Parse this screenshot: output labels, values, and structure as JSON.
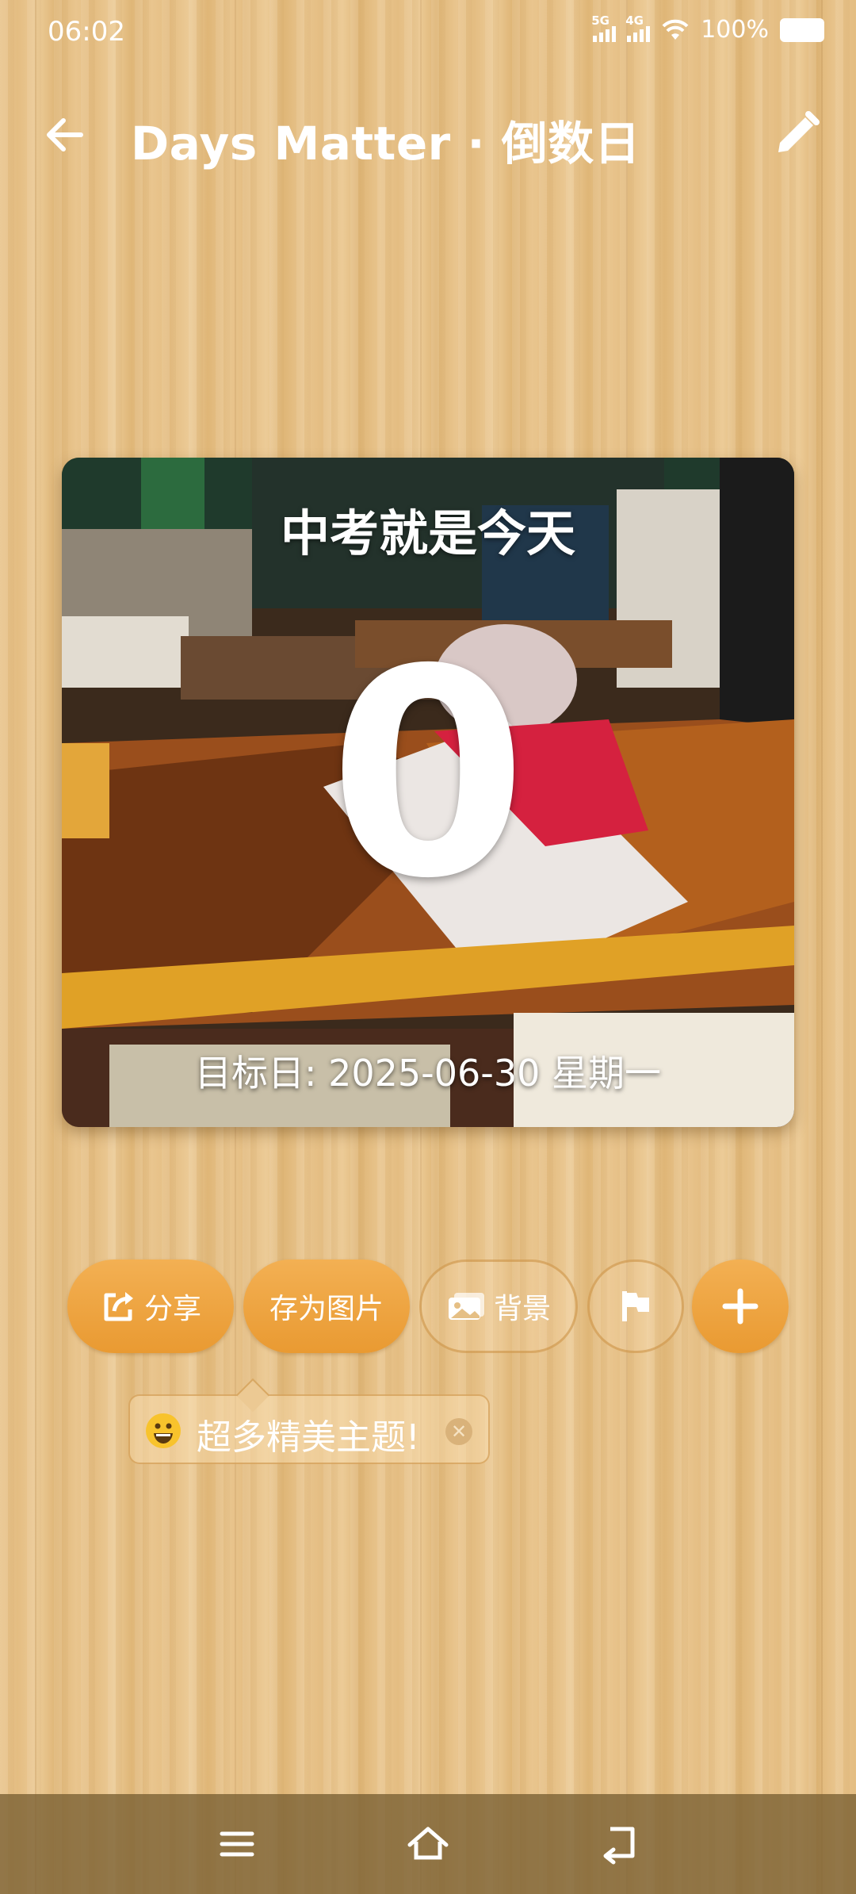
{
  "status": {
    "time": "06:02",
    "net1": "5G",
    "net2": "4G",
    "battery": "100%"
  },
  "appbar": {
    "title": "Days Matter · 倒数日"
  },
  "card": {
    "event_title": "中考就是今天",
    "days": "0",
    "target_label": "目标日: 2025-06-30 星期一"
  },
  "actions": {
    "share": "分享",
    "save_image": "存为图片",
    "background": "背景"
  },
  "tip": {
    "text": "超多精美主题!"
  },
  "colors": {
    "accent": "#EFA541",
    "wood": "#E7C188",
    "nav": "#7D6232"
  },
  "icons": [
    "back-arrow-icon",
    "edit-pencil-icon",
    "share-icon",
    "image-icon",
    "flag-icon",
    "plus-icon",
    "smile-emoji-icon",
    "close-icon",
    "menu-icon",
    "home-icon",
    "back-icon"
  ]
}
